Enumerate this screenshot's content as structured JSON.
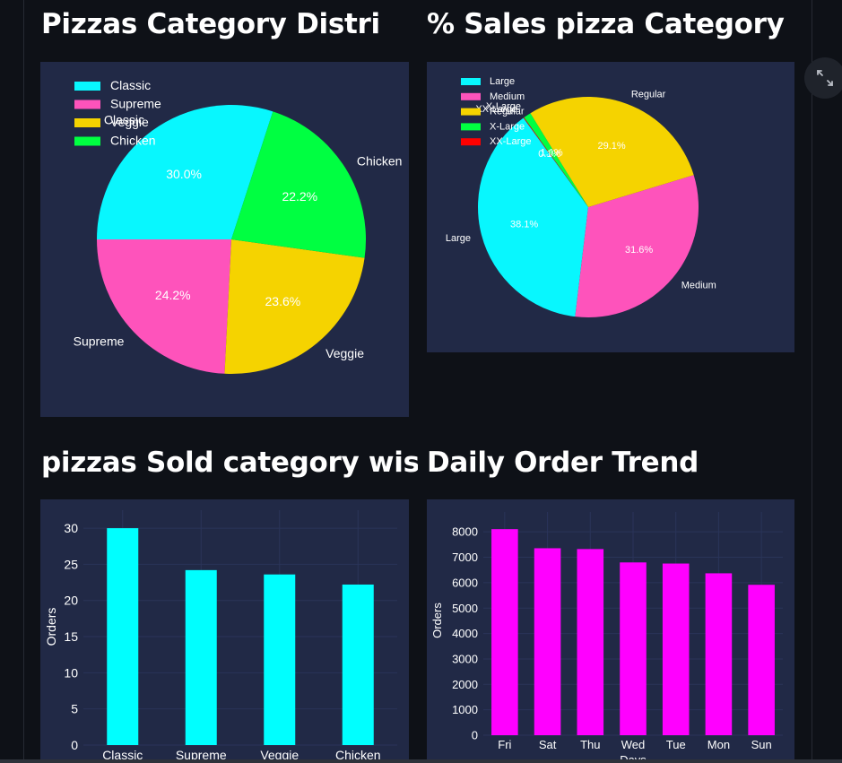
{
  "colors": {
    "page_bg": "#0e1117",
    "panel_bg": "#212946",
    "text": "#ffffff",
    "classic": "#08F7FE",
    "supreme": "#FE53BB",
    "veggie": "#F5D300",
    "chicken": "#00ff41",
    "xxlarge": "#ff0000",
    "bar_orders": "#00ffff",
    "bar_daily": "#ff00ff"
  },
  "icons": {
    "expand": "expand-arrows-icon"
  },
  "titles": {
    "chart1": "Pizzas Category Distri",
    "chart2": "% Sales pizza Category",
    "chart3": "pizzas Sold category wise",
    "chart4": "Daily Order Trend"
  },
  "chart_data": [
    {
      "type": "pie",
      "title": "Pizzas Category Distri",
      "labels": [
        "Classic",
        "Supreme",
        "Veggie",
        "Chicken"
      ],
      "values": [
        30.0,
        24.2,
        23.6,
        22.2
      ],
      "value_labels": [
        "30.0%",
        "24.2%",
        "23.6%",
        "22.2%"
      ],
      "legend": [
        "Classic",
        "Supreme",
        "Veggie",
        "Chicken"
      ],
      "legend_position": "top-left"
    },
    {
      "type": "pie",
      "title": "% Sales pizza Category",
      "labels": [
        "Large",
        "Medium",
        "Regular",
        "X-Large",
        "XX-Large"
      ],
      "values": [
        38.1,
        31.6,
        29.1,
        1.1,
        0.1
      ],
      "value_labels": [
        "38.1%",
        "31.6%",
        "29.1%",
        "1.1%",
        "0.1%"
      ],
      "legend": [
        "Large",
        "Medium",
        "Regular",
        "X-Large",
        "XX-Large"
      ],
      "legend_position": "top-left"
    },
    {
      "type": "bar",
      "title": "pizzas Sold category wise",
      "categories": [
        "Classic",
        "Supreme",
        "Veggie",
        "Chicken"
      ],
      "values": [
        30.0,
        24.2,
        23.6,
        22.2
      ],
      "ylabel": "Orders",
      "yticks": [
        0,
        5,
        10,
        15,
        20,
        25,
        30
      ],
      "ylim": [
        0,
        31.5
      ],
      "grid": true
    },
    {
      "type": "bar",
      "title": "Daily Order Trend",
      "categories": [
        "Fri",
        "Sat",
        "Thu",
        "Wed",
        "Tue",
        "Mon",
        "Sun"
      ],
      "values": [
        8106,
        7355,
        7323,
        6797,
        6753,
        6369,
        5917
      ],
      "xlabel": "Days",
      "ylabel": "Orders",
      "yticks": [
        0,
        1000,
        2000,
        3000,
        4000,
        5000,
        6000,
        7000,
        8000
      ],
      "ylim": [
        0,
        8500
      ],
      "grid": true
    }
  ]
}
